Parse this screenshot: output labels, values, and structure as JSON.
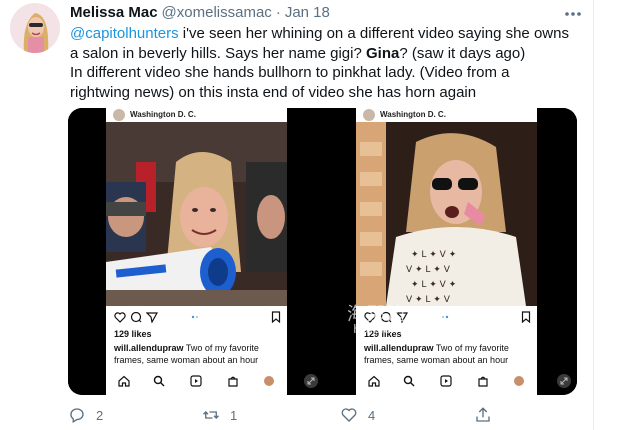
{
  "tweet": {
    "display_name": "Melissa Mac",
    "handle": "@xomelissamac",
    "separator": "·",
    "date": "Jan 18",
    "text": {
      "mention": "@capitolhunters",
      "line1_rest": " i've seen her whining on a different video saying she owns",
      "line2": "a salon in beverly hills. Says her name gigi? ",
      "bold": "Gina",
      "line2_end": "? (saw it days ago)",
      "line3": "In different video she hands bullhorn to pinkhat lady. (Video from a",
      "line4": "rightwing news) on this insta end of video she has horn again"
    }
  },
  "media": {
    "left_post": {
      "location": "Washington D. C.",
      "likes": "129 likes",
      "caption_user": "will.allendupraw",
      "caption_text": " Two of my favorite frames, same woman about an hour"
    },
    "right_post": {
      "location": "Washington D. C.",
      "likes": "129 likes",
      "caption_user": "will.allendupraw",
      "caption_text": " Two of my favorite frames, same woman about an hour"
    },
    "watermark": {
      "cn": "海那边",
      "en": "Haibian"
    }
  },
  "actions": {
    "reply_count": "2",
    "retweet_count": "1",
    "like_count": "4",
    "icons": [
      "reply-icon",
      "retweet-icon",
      "like-icon",
      "share-icon"
    ]
  },
  "colors": {
    "link": "#1b95e0",
    "secondary_text": "#5b7083",
    "megaphone_blue": "#1e5fd0"
  }
}
